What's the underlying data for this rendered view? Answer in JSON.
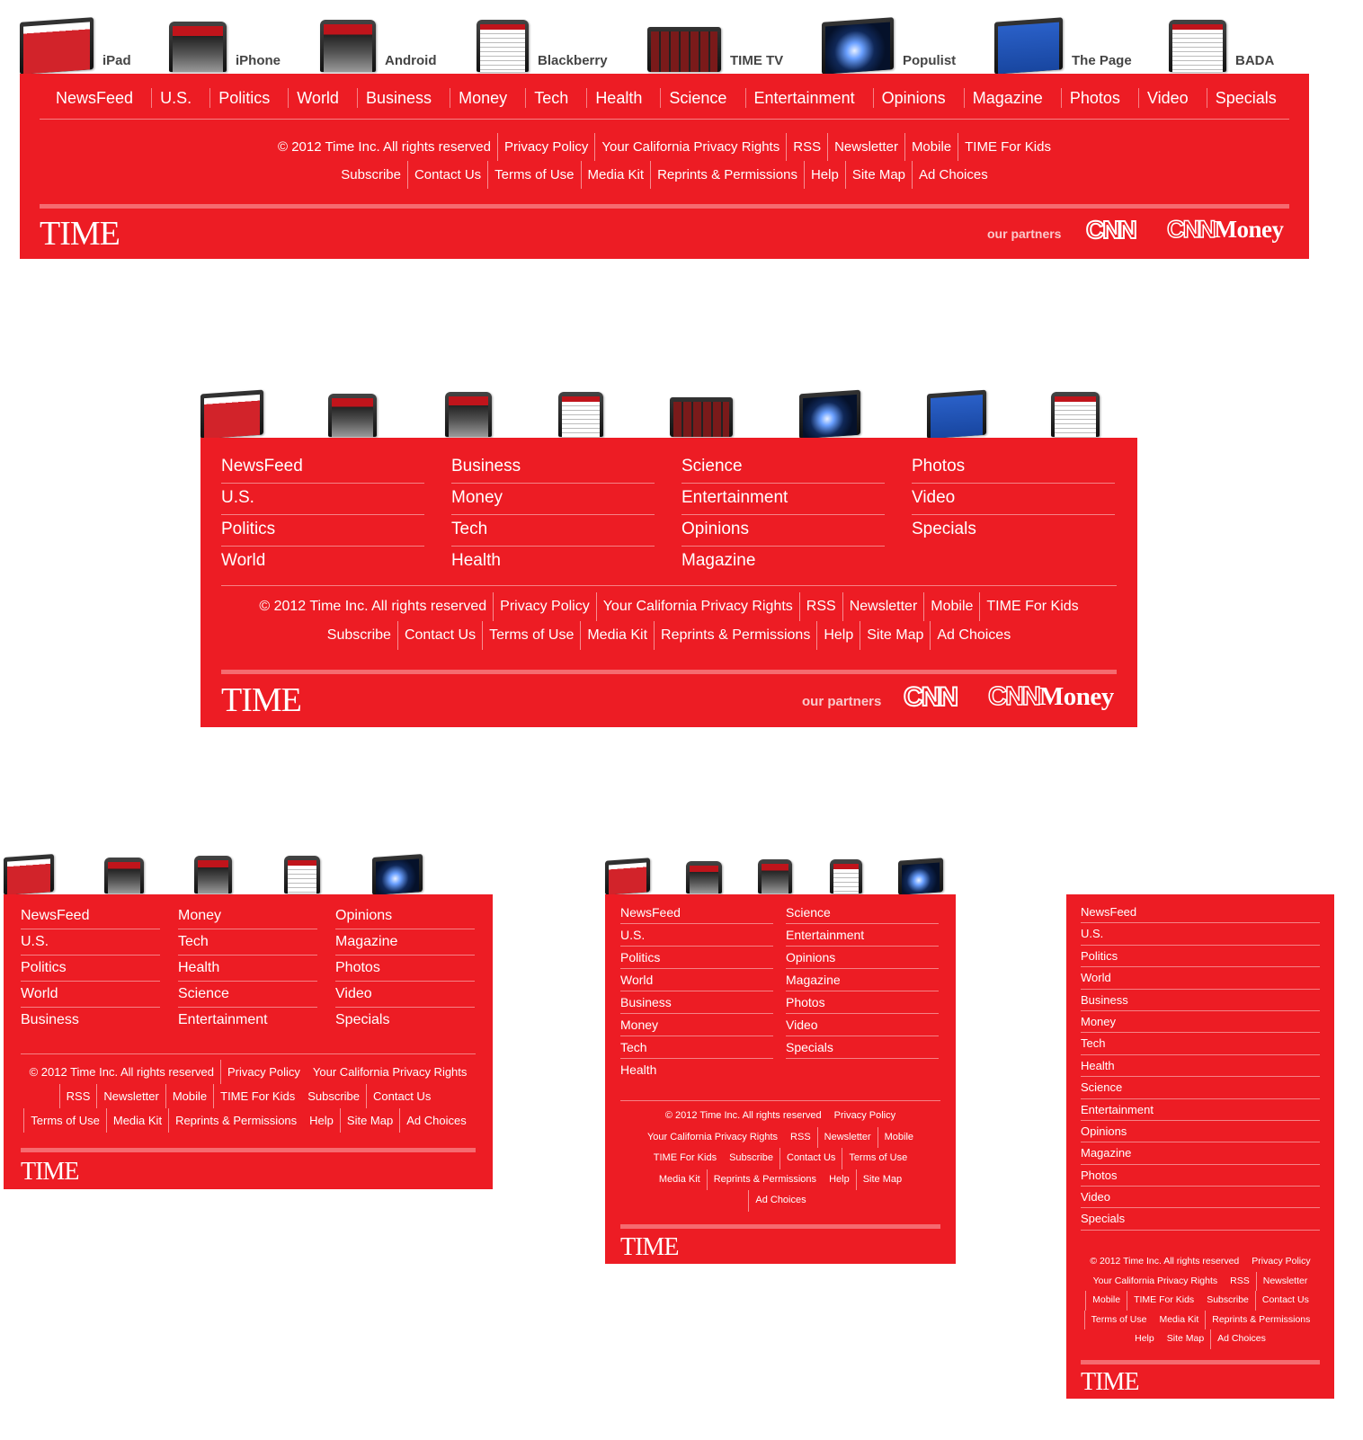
{
  "devices": [
    {
      "name": "ipad",
      "label": "iPad"
    },
    {
      "name": "iphone",
      "label": "iPhone"
    },
    {
      "name": "android",
      "label": "Android"
    },
    {
      "name": "blackberry",
      "label": "Blackberry"
    },
    {
      "name": "time-tv",
      "label": "TIME TV"
    },
    {
      "name": "populist",
      "label": "Populist"
    },
    {
      "name": "the-page",
      "label": "The Page"
    },
    {
      "name": "bada",
      "label": "BADA"
    }
  ],
  "nav": [
    "NewsFeed",
    "U.S.",
    "Politics",
    "World",
    "Business",
    "Money",
    "Tech",
    "Health",
    "Science",
    "Entertainment",
    "Opinions",
    "Magazine",
    "Photos",
    "Video",
    "Specials"
  ],
  "links": {
    "copyright": "© 2012 Time Inc. All rights reserved",
    "privacy": "Privacy Policy",
    "california": "Your California Privacy Rights",
    "rss": "RSS",
    "newsletter": "Newsletter",
    "mobile": "Mobile",
    "kids": "TIME For Kids",
    "subscribe": "Subscribe",
    "contact": "Contact Us",
    "terms": "Terms of Use",
    "mediakit": "Media Kit",
    "reprints": "Reprints & Permissions",
    "help": "Help",
    "sitemap": "Site Map",
    "adchoices": "Ad Choices"
  },
  "brand": {
    "logo": "TIME",
    "partners_label": "our partners",
    "partner_cnn": "CNN",
    "partner_money": "Money",
    "accent": "#ed1c24"
  }
}
